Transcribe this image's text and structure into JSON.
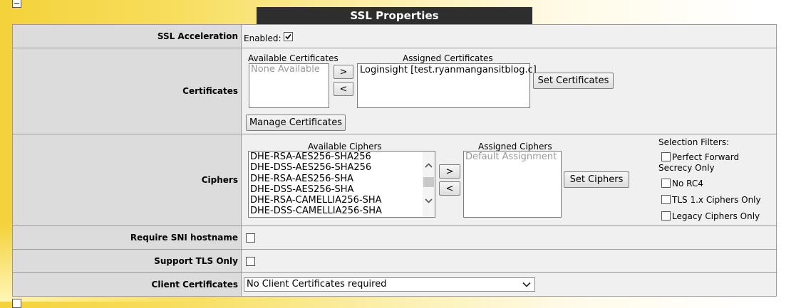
{
  "title": "SSL Properties",
  "rows": {
    "ssl_acceleration": {
      "label": "SSL Acceleration",
      "enabled_label": "Enabled:",
      "enabled": true
    },
    "certificates": {
      "label": "Certificates",
      "available_caption": "Available Certificates",
      "available_placeholder": "None Available",
      "assigned_caption": "Assigned Certificates",
      "assigned_items": [
        "Loginsight [test.ryanmangansitblog.c]"
      ],
      "move_right": ">",
      "move_left": "<",
      "set_button": "Set Certificates",
      "manage_button": "Manage Certificates"
    },
    "ciphers": {
      "label": "Ciphers",
      "available_caption": "Available Ciphers",
      "available_items": [
        "DHE-RSA-AES256-SHA256",
        "DHE-DSS-AES256-SHA256",
        "DHE-RSA-AES256-SHA",
        "DHE-DSS-AES256-SHA",
        "DHE-RSA-CAMELLIA256-SHA",
        "DHE-DSS-CAMELLIA256-SHA"
      ],
      "move_right": ">",
      "move_left": "<",
      "assigned_caption": "Assigned Ciphers",
      "assigned_placeholder": "Default Assignment",
      "set_button": "Set Ciphers",
      "filters_caption": "Selection Filters:",
      "filters": [
        {
          "label": "Perfect Forward Secrecy Only",
          "checked": false
        },
        {
          "label": "No RC4",
          "checked": false
        },
        {
          "label": "TLS 1.x Ciphers Only",
          "checked": false
        },
        {
          "label": "Legacy Ciphers Only",
          "checked": false
        }
      ]
    },
    "require_sni": {
      "label": "Require SNI hostname",
      "checked": false
    },
    "support_tls_only": {
      "label": "Support TLS Only",
      "checked": false
    },
    "client_certificates": {
      "label": "Client Certificates",
      "selected": "No Client Certificates required"
    }
  }
}
